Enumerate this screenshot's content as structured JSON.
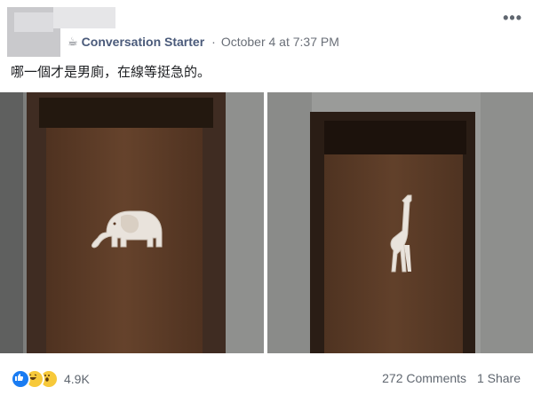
{
  "header": {
    "author": "Conversation Starter",
    "separator": "·",
    "date": "October 4 at 7:37 PM",
    "cup_icon": "coffee-cup-icon",
    "more_label": "•••"
  },
  "post": {
    "text": "哪一個才是男廁，在線等挺急的。"
  },
  "photos": {
    "left_sign_icon": "elephant-sign-icon",
    "right_sign_icon": "giraffe-sign-icon"
  },
  "stats": {
    "reaction_icons": [
      "like-icon",
      "haha-icon",
      "wow-icon"
    ],
    "reaction_count": "4.9K",
    "comments": "272 Comments",
    "shares": "1 Share"
  },
  "colors": {
    "author": "#4a5a7a",
    "meta": "#6a6f78",
    "like_blue": "#1a7cf2",
    "emoji_yellow": "#f7c93a"
  }
}
